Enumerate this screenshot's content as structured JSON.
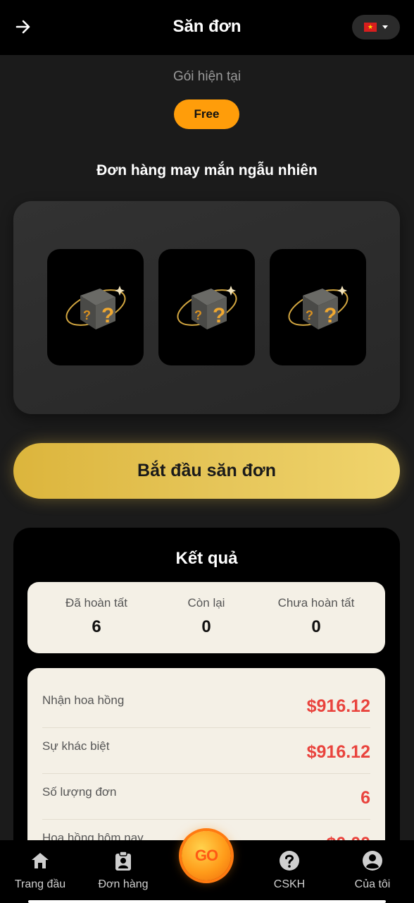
{
  "header": {
    "title": "Săn đơn",
    "back_icon": "arrow-right-icon",
    "language_flag": "vietnam-flag-icon",
    "flag_star": "★"
  },
  "package": {
    "label": "Gói hiện tại",
    "badge": "Free",
    "badge_color": "#ff9d0a"
  },
  "lucky": {
    "title": "Đơn hàng may mắn ngẫu nhiên",
    "box_glyph": "?",
    "boxes": [
      {
        "icon": "mystery-box-icon"
      },
      {
        "icon": "mystery-box-icon"
      },
      {
        "icon": "mystery-box-icon"
      }
    ]
  },
  "start_button": {
    "label": "Bắt đầu săn đơn",
    "accent": "#e6c65a"
  },
  "results": {
    "title": "Kết quả",
    "stats": [
      {
        "label": "Đã hoàn tất",
        "value": "6"
      },
      {
        "label": "Còn lại",
        "value": "0"
      },
      {
        "label": "Chưa hoàn tất",
        "value": "0"
      }
    ],
    "details": [
      {
        "label": "Nhận hoa hồng",
        "value": "$916.12"
      },
      {
        "label": "Sự khác biệt",
        "value": "$916.12"
      },
      {
        "label": "Số lượng đơn",
        "value": "6"
      },
      {
        "label": "Hoa hồng hôm nay",
        "value": "$0.00"
      }
    ],
    "value_color": "#e9433d"
  },
  "nav": {
    "items": [
      {
        "label": "Trang đầu",
        "icon": "home-icon"
      },
      {
        "label": "Đơn hàng",
        "icon": "clipboard-user-icon"
      },
      {
        "label": "CSKH",
        "icon": "help-circle-icon"
      },
      {
        "label": "Của tôi",
        "icon": "user-circle-icon"
      }
    ],
    "go_label": "GO",
    "go_icon": "go-coin-icon"
  }
}
